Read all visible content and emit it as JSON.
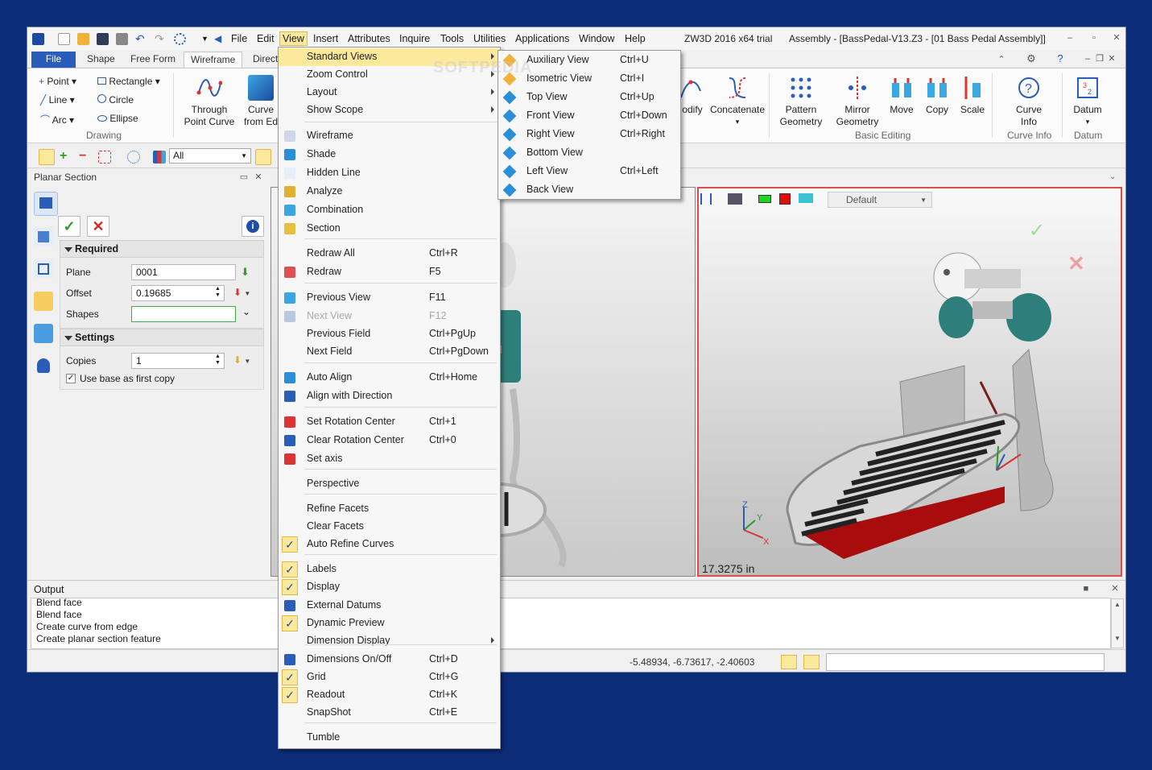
{
  "menubar": {
    "items": [
      "File",
      "Edit",
      "View",
      "Insert",
      "Attributes",
      "Inquire",
      "Tools",
      "Utilities",
      "Applications",
      "Window",
      "Help"
    ],
    "app_title": "ZW3D 2016  x64 trial",
    "doc_title": "Assembly - [BassPedal-V13.Z3 - [01 Bass Pedal Assembly]]"
  },
  "tabs": [
    "File",
    "Shape",
    "Free Form",
    "Wireframe",
    "Direct"
  ],
  "ribbon": {
    "drawing_small": [
      "Point",
      "Rectangle",
      "Line",
      "Circle",
      "Arc",
      "Ellipse"
    ],
    "through_point": "Through\nPoint Curve",
    "curve_from_edge": "Curve\nfrom Ed",
    "modify": "odify",
    "concatenate": "Concatenate",
    "pattern": "Pattern\nGeometry",
    "mirror": "Mirror\nGeometry",
    "move": "Move",
    "copy": "Copy",
    "scale": "Scale",
    "curve_info": "Curve\nInfo",
    "datum": "Datum",
    "groups": {
      "drawing": "Drawing",
      "basic_editing": "Basic Editing",
      "curve_info": "Curve Info",
      "datum": "Datum"
    }
  },
  "toolbar": {
    "filter_value": "All"
  },
  "panel": {
    "title": "Planar Section",
    "required": "Required",
    "plane_label": "Plane",
    "plane_value": "0001",
    "offset_label": "Offset",
    "offset_value": "0.19685",
    "shapes_label": "Shapes",
    "settings": "Settings",
    "copies_label": "Copies",
    "copies_value": "1",
    "use_base": "Use base as first copy"
  },
  "viewport": {
    "right_dim": "17.3275 in",
    "style_default": "Default"
  },
  "output": {
    "title": "Output",
    "lines": [
      "Blend face",
      "Blend face",
      "Create curve from edge",
      "Create planar section feature"
    ]
  },
  "status": {
    "coords": "-5.48934, -6.73617, -2.40603"
  },
  "view_menu": {
    "items": [
      {
        "label": "Standard Views",
        "accel": "",
        "sub": true
      },
      {
        "label": "Zoom Control",
        "accel": "",
        "sub": true
      },
      {
        "label": "Layout",
        "accel": "",
        "sub": true
      },
      {
        "label": "Show Scope",
        "accel": "",
        "sub": true
      },
      {
        "label": "Wireframe",
        "accel": ""
      },
      {
        "label": "Shade",
        "accel": ""
      },
      {
        "label": "Hidden Line",
        "accel": ""
      },
      {
        "label": "Analyze",
        "accel": ""
      },
      {
        "label": "Combination",
        "accel": ""
      },
      {
        "label": "Section",
        "accel": ""
      },
      {
        "label": "Redraw All",
        "accel": "Ctrl+R"
      },
      {
        "label": "Redraw",
        "accel": "F5"
      },
      {
        "label": "Previous View",
        "accel": "F11"
      },
      {
        "label": "Next View",
        "accel": "F12"
      },
      {
        "label": "Previous Field",
        "accel": "Ctrl+PgUp"
      },
      {
        "label": "Next Field",
        "accel": "Ctrl+PgDown"
      },
      {
        "label": "Auto Align",
        "accel": "Ctrl+Home"
      },
      {
        "label": "Align with Direction",
        "accel": ""
      },
      {
        "label": "Set Rotation Center",
        "accel": "Ctrl+1"
      },
      {
        "label": "Clear Rotation Center",
        "accel": "Ctrl+0"
      },
      {
        "label": "Set axis",
        "accel": ""
      },
      {
        "label": "Perspective",
        "accel": ""
      },
      {
        "label": "Refine Facets",
        "accel": ""
      },
      {
        "label": "Clear Facets",
        "accel": ""
      },
      {
        "label": "Auto Refine Curves",
        "accel": ""
      },
      {
        "label": "Labels",
        "accel": ""
      },
      {
        "label": "Display",
        "accel": ""
      },
      {
        "label": "External Datums",
        "accel": ""
      },
      {
        "label": "Dynamic Preview",
        "accel": ""
      },
      {
        "label": "Dimension Display",
        "accel": "",
        "sub": true
      },
      {
        "label": "Dimensions On/Off",
        "accel": "Ctrl+D"
      },
      {
        "label": "Grid",
        "accel": "Ctrl+G"
      },
      {
        "label": "Readout",
        "accel": "Ctrl+K"
      },
      {
        "label": "SnapShot",
        "accel": "Ctrl+E"
      },
      {
        "label": "Tumble",
        "accel": ""
      }
    ]
  },
  "standard_views": [
    {
      "label": "Auxiliary View",
      "accel": "Ctrl+U"
    },
    {
      "label": "Isometric View",
      "accel": "Ctrl+I"
    },
    {
      "label": "Top View",
      "accel": "Ctrl+Up"
    },
    {
      "label": "Front View",
      "accel": "Ctrl+Down"
    },
    {
      "label": "Right View",
      "accel": "Ctrl+Right"
    },
    {
      "label": "Bottom View",
      "accel": ""
    },
    {
      "label": "Left View",
      "accel": "Ctrl+Left"
    },
    {
      "label": "Back View",
      "accel": ""
    }
  ],
  "watermark": "SOFTPEDIA",
  "colors": {
    "accent_blue": "#2a5db8",
    "menu_highlight": "#fde99b",
    "desktop": "#0d2c78",
    "teal_part": "#2e7f7c"
  }
}
